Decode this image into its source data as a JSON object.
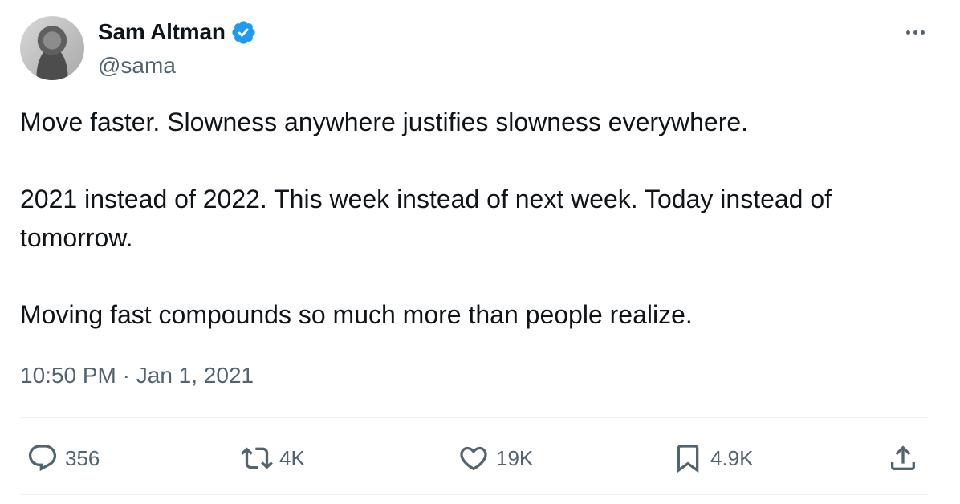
{
  "author": {
    "name": "Sam Altman",
    "handle": "@sama",
    "verified": true,
    "verified_color": "#1d9bf0"
  },
  "tweet": {
    "paragraphs": [
      "Move faster. Slowness anywhere justifies slowness everywhere.",
      "2021 instead of 2022. This week instead of next week. Today instead of tomorrow.",
      "Moving fast compounds so much more than people realize."
    ],
    "time": "10:50 PM",
    "separator": "·",
    "date": "Jan 1, 2021"
  },
  "actions": {
    "reply": {
      "icon": "reply-icon",
      "count": "356"
    },
    "retweet": {
      "icon": "retweet-icon",
      "count": "4K"
    },
    "like": {
      "icon": "like-icon",
      "count": "19K"
    },
    "bookmark": {
      "icon": "bookmark-icon",
      "count": "4.9K"
    },
    "share": {
      "icon": "share-icon"
    }
  },
  "colors": {
    "text": "#0f1419",
    "secondary": "#536471",
    "divider": "#eff3f4"
  }
}
